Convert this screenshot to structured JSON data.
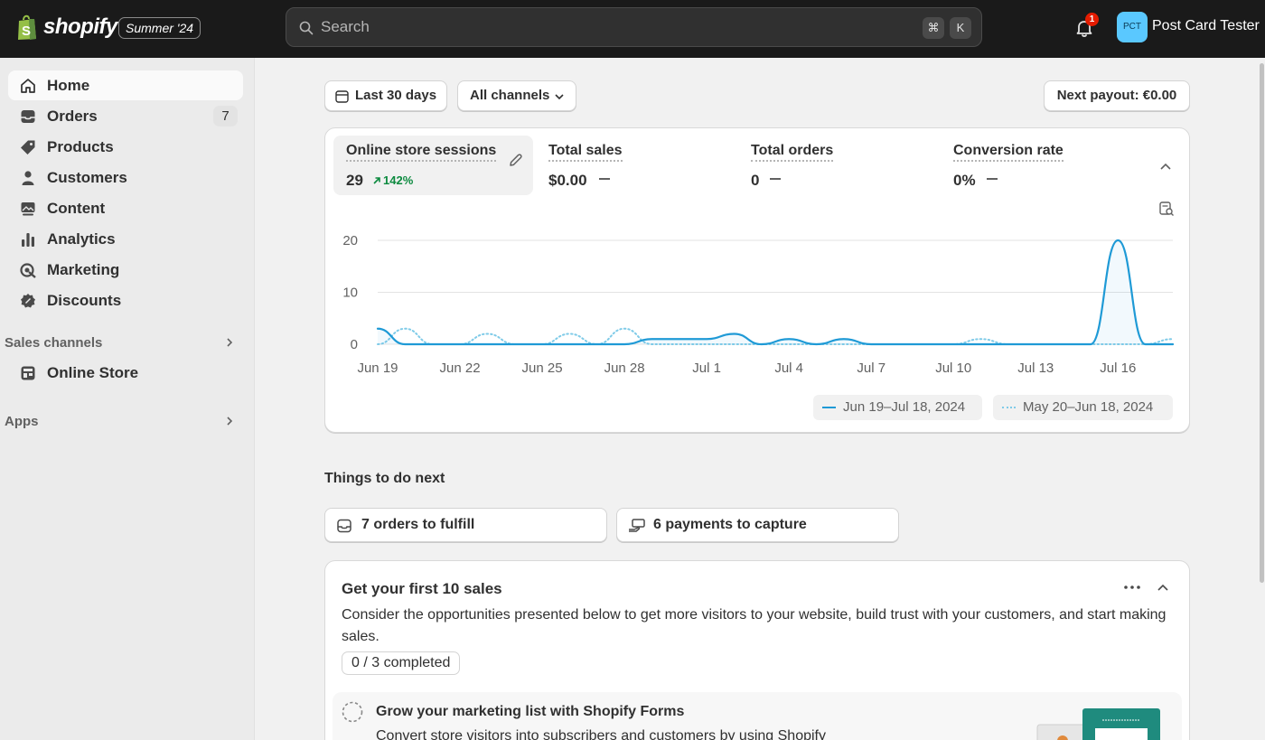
{
  "topbar": {
    "brand": "shopify",
    "edition": "Summer '24",
    "search_placeholder": "Search",
    "shortcut_cmd": "⌘",
    "shortcut_key": "K",
    "notification_count": "1",
    "avatar_initials": "PCT",
    "store_name": "Post Card Tester"
  },
  "sidebar": {
    "items": [
      {
        "label": "Home",
        "icon": "home-icon",
        "active": true
      },
      {
        "label": "Orders",
        "icon": "inbox-icon",
        "count": "7"
      },
      {
        "label": "Products",
        "icon": "tag-icon"
      },
      {
        "label": "Customers",
        "icon": "person-icon"
      },
      {
        "label": "Content",
        "icon": "image-icon"
      },
      {
        "label": "Analytics",
        "icon": "bar-chart-icon"
      },
      {
        "label": "Marketing",
        "icon": "target-icon"
      },
      {
        "label": "Discounts",
        "icon": "discount-icon"
      }
    ],
    "sales_channels_label": "Sales channels",
    "online_store_label": "Online Store",
    "apps_label": "Apps"
  },
  "filters": {
    "date_range": "Last 30 days",
    "channels": "All channels",
    "payout": "Next payout: €0.00"
  },
  "metrics": [
    {
      "title": "Online store sessions",
      "value": "29",
      "trend": "142%"
    },
    {
      "title": "Total sales",
      "value": "$0.00"
    },
    {
      "title": "Total orders",
      "value": "0"
    },
    {
      "title": "Conversion rate",
      "value": "0%"
    }
  ],
  "chart_data": {
    "type": "line",
    "x": [
      "Jun 19",
      "Jun 20",
      "Jun 21",
      "Jun 22",
      "Jun 23",
      "Jun 24",
      "Jun 25",
      "Jun 26",
      "Jun 27",
      "Jun 28",
      "Jun 29",
      "Jun 30",
      "Jul 1",
      "Jul 2",
      "Jul 3",
      "Jul 4",
      "Jul 5",
      "Jul 6",
      "Jul 7",
      "Jul 8",
      "Jul 9",
      "Jul 10",
      "Jul 11",
      "Jul 12",
      "Jul 13",
      "Jul 14",
      "Jul 15",
      "Jul 16",
      "Jul 17",
      "Jul 18"
    ],
    "x_tick_labels": [
      "Jun 19",
      "Jun 22",
      "Jun 25",
      "Jun 28",
      "Jul 1",
      "Jul 4",
      "Jul 7",
      "Jul 10",
      "Jul 13",
      "Jul 16"
    ],
    "series": [
      {
        "name": "Jun 19–Jul 18, 2024",
        "style": "solid",
        "color": "#1f9ad6",
        "values": [
          3,
          0,
          0,
          0,
          0,
          0,
          0,
          0,
          0,
          0,
          1,
          1,
          1,
          2,
          0,
          1,
          0,
          1,
          0,
          0,
          0,
          0,
          0,
          0,
          0,
          0,
          0,
          20,
          0,
          0
        ]
      },
      {
        "name": "May 20–Jun 18, 2024",
        "style": "dotted",
        "color": "#7fcbe8",
        "values": [
          0,
          3,
          0,
          0,
          2,
          0,
          0,
          2,
          0,
          3,
          0,
          0,
          0,
          0,
          0,
          0,
          0,
          0,
          0,
          0,
          0,
          0,
          1,
          0,
          0,
          0,
          0,
          0,
          0,
          1
        ]
      }
    ],
    "y_ticks": [
      "0",
      "10",
      "20"
    ],
    "ylim": [
      0,
      20
    ],
    "grid": true
  },
  "todo": {
    "heading": "Things to do next",
    "fulfill": "7 orders to fulfill",
    "capture": "6 payments to capture"
  },
  "setup": {
    "title": "Get your first 10 sales",
    "description": "Consider the opportunities presented below to get more visitors to your website, build trust with your customers, and start making sales.",
    "progress": "0 / 3 completed",
    "task_title": "Grow your marketing list with Shopify Forms",
    "task_desc": "Convert store visitors into subscribers and customers by using Shopify"
  },
  "colors": {
    "accent": "#1f9ad6",
    "positive": "#0c8a3f",
    "topbar": "#1a1a1a"
  }
}
